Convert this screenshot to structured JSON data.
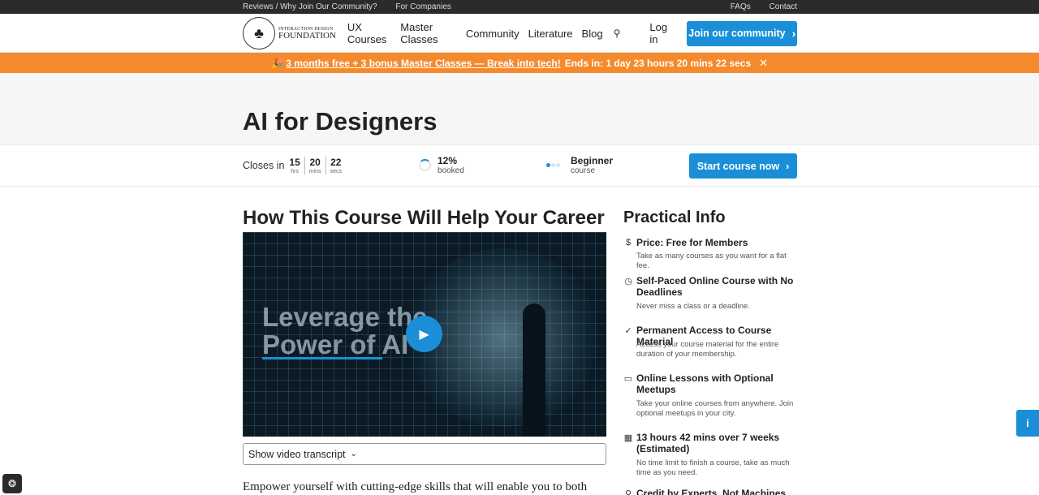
{
  "topbar": {
    "reviews": "Reviews / Why Join Our Community?",
    "companies": "For Companies",
    "faqs": "FAQs",
    "contact": "Contact"
  },
  "nav": {
    "logo_line1": "INTERACTION DESIGN",
    "logo_line2": "FOUNDATION",
    "links": [
      "UX Courses",
      "Master Classes",
      "Community",
      "Literature",
      "Blog"
    ],
    "login": "Log in",
    "join": "Join our community"
  },
  "promo": {
    "icon": "🎉",
    "offer": "3 months free + 3 bonus Master Classes — Break into tech!",
    "ends": "Ends in: 1 day 23 hours 20 mins 22 secs"
  },
  "course": {
    "title": "AI for Designers",
    "closes_label": "Closes in",
    "hours": "15",
    "hours_unit": "hrs",
    "mins": "20",
    "mins_unit": "mins",
    "secs": "22",
    "secs_unit": "secs",
    "booked_value": "12%",
    "booked_label": "booked",
    "level": "Beginner",
    "level_label": "course",
    "start": "Start course now"
  },
  "main": {
    "heading": "How This Course Will Help Your Career",
    "video_line1": "Leverage the",
    "video_line2": "Power of AI",
    "transcript": "Show video transcript",
    "intro": "Empower yourself with cutting-edge skills that will enable you to both"
  },
  "practical": {
    "heading": "Practical Info",
    "items": [
      {
        "icon": "$",
        "title": "Price: Free for Members",
        "desc": "Take as many courses as you want for a flat fee."
      },
      {
        "icon": "◷",
        "title": "Self-Paced Online Course with No Deadlines",
        "desc": "Never miss a class or a deadline."
      },
      {
        "icon": "✓",
        "title": "Permanent Access to Course Material",
        "desc": "Access your course material for the entire duration of your membership."
      },
      {
        "icon": "▭",
        "title": "Online Lessons with Optional Meetups",
        "desc": "Take your online courses from anywhere. Join optional meetups in your city."
      },
      {
        "icon": "▦",
        "title": "13 hours 42 mins over 7 weeks (Estimated)",
        "desc": "No time limit to finish a course, take as much time as you need."
      },
      {
        "icon": "⚲",
        "title": "Credit by Experts, Not Machines",
        "desc": ""
      }
    ]
  },
  "colors": {
    "accent": "#1a8fd8",
    "promo": "#f58a2d",
    "topbar": "#2b2b2b"
  }
}
